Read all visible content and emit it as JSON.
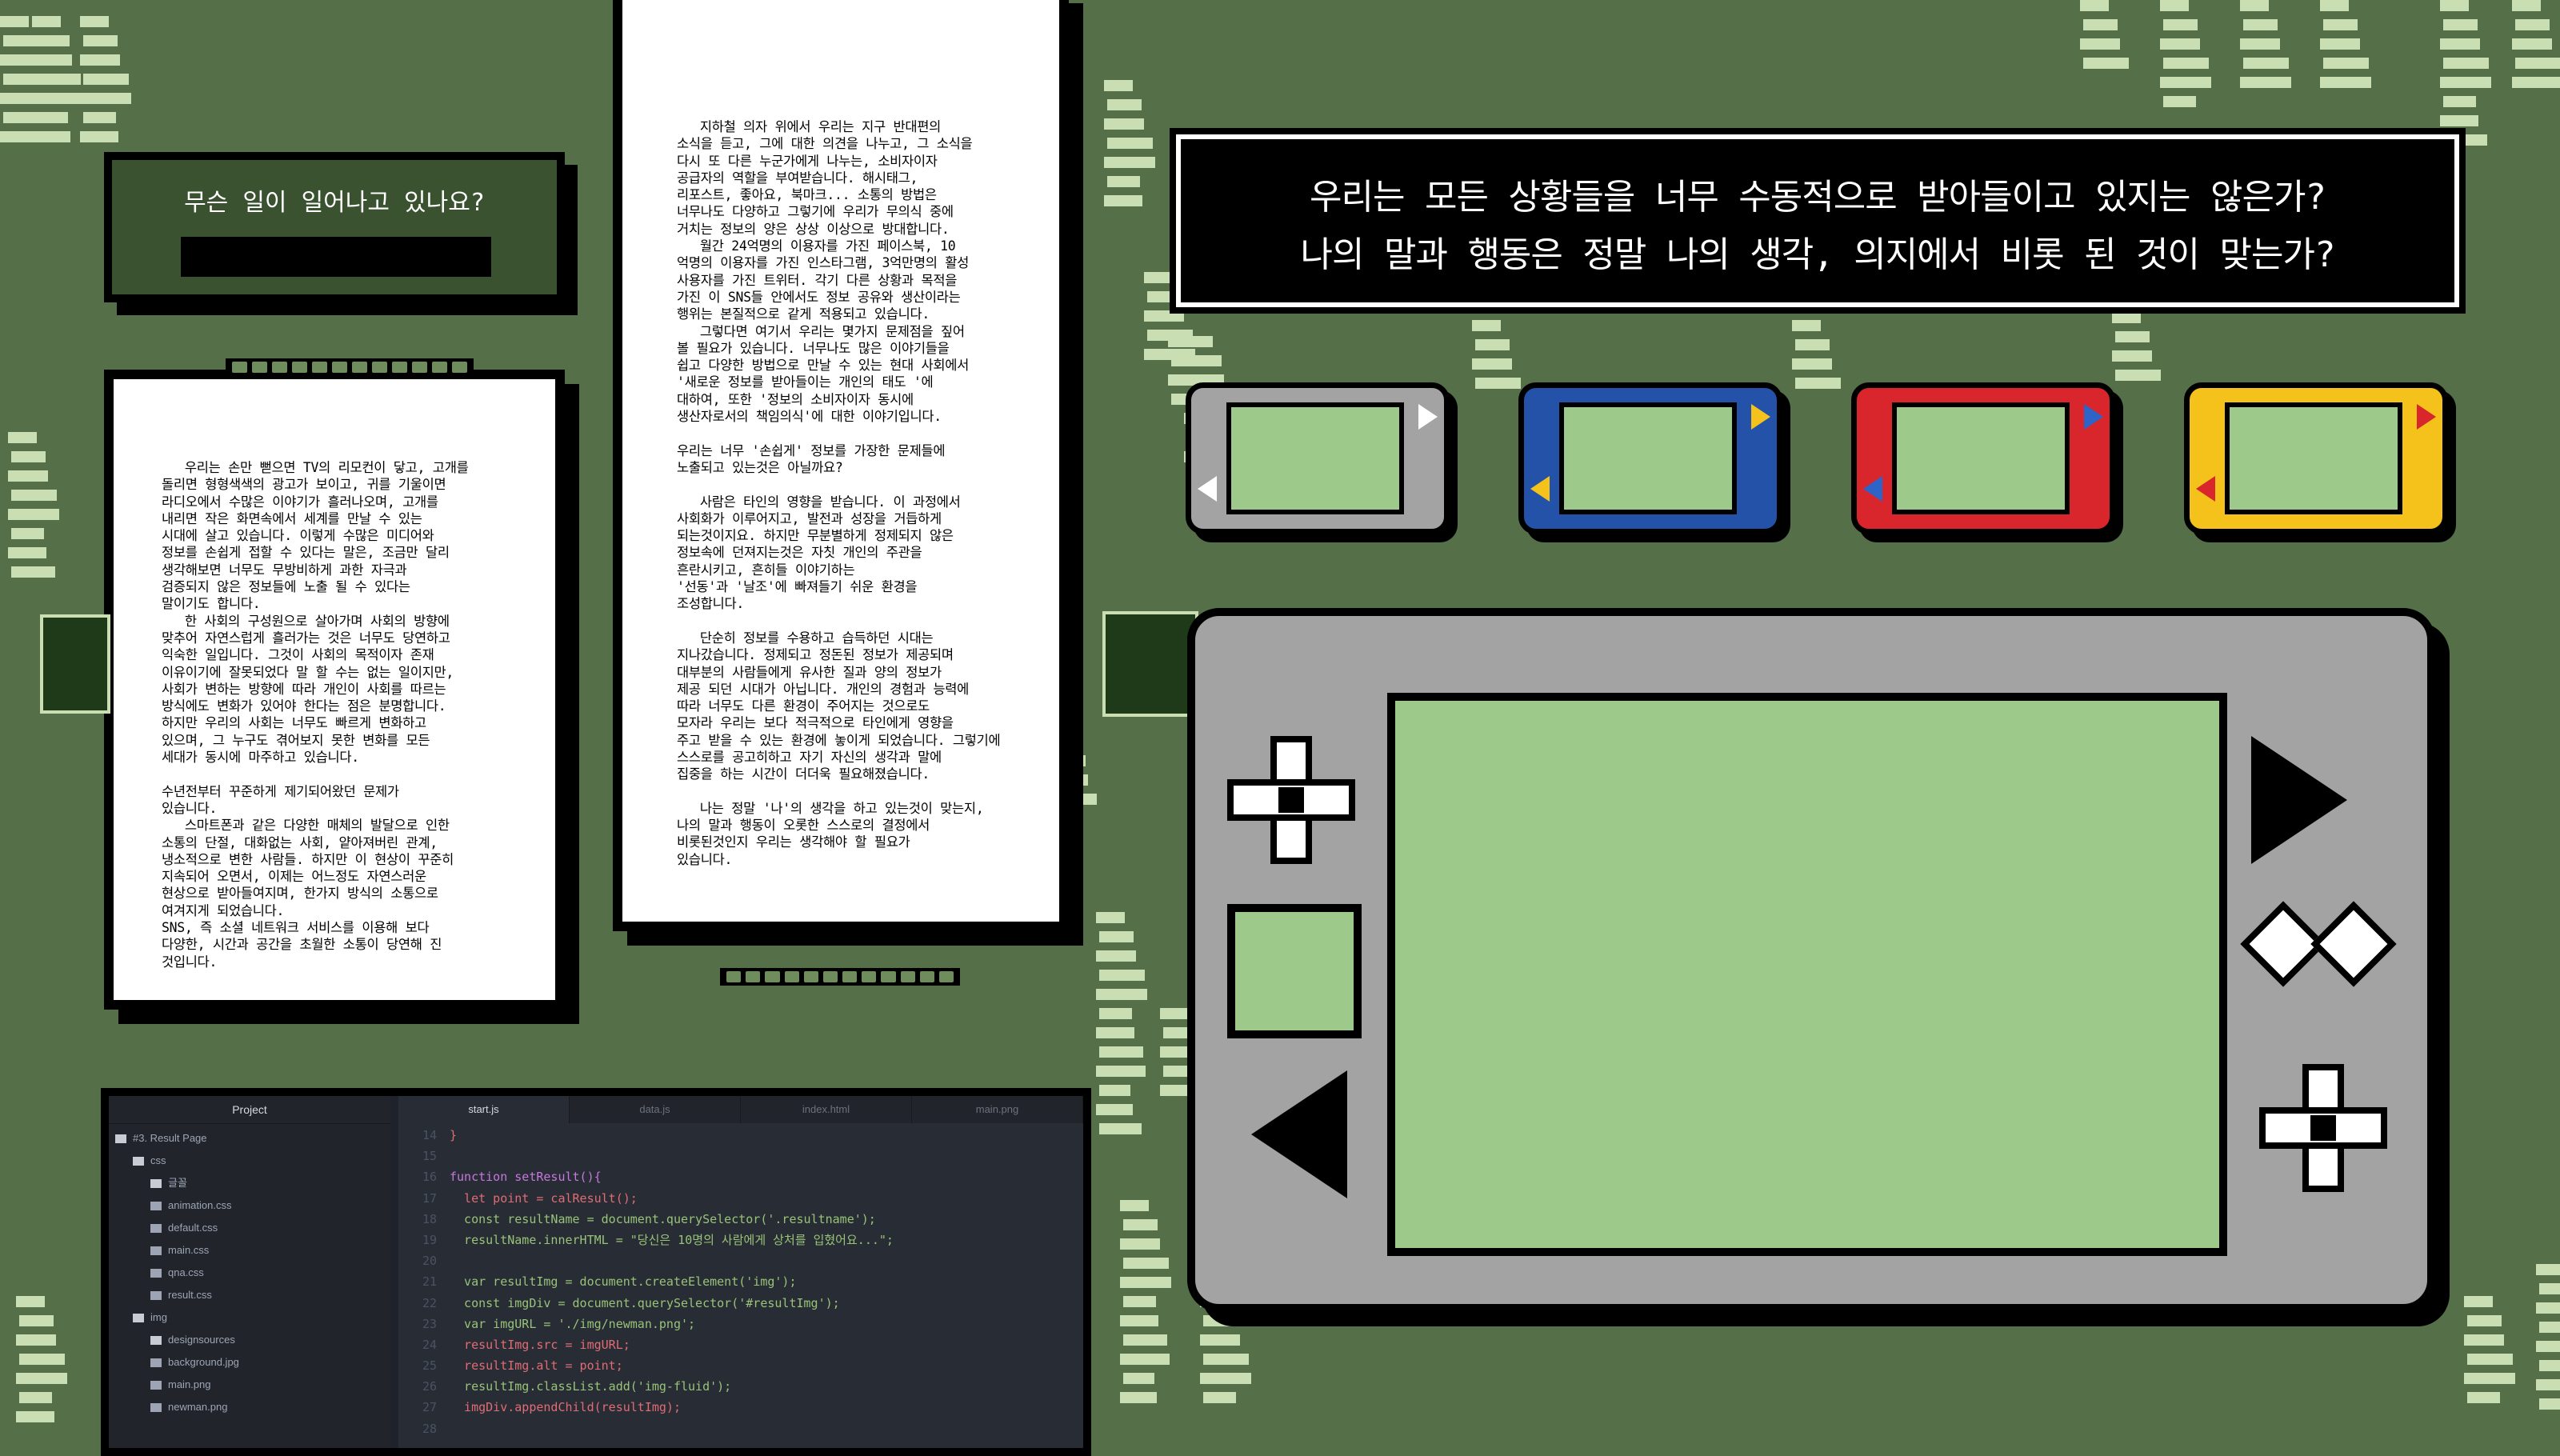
{
  "colors": {
    "background": "#557048",
    "bars": "#c9dfb3",
    "screen": "#9dca8b"
  },
  "question_window": {
    "title": "무슨 일이 일어나고 있나요?"
  },
  "left_paper": {
    "text": "   우리는 손만 뻗으면 TV의 리모컨이 닿고, 고개를\n돌리면 형형색색의 광고가 보이고, 귀를 기울이면\n라디오에서 수많은 이야기가 흘러나오며, 고개를\n내리면 작은 화면속에서 세계를 만날 수 있는\n시대에 살고 있습니다. 이렇게 수많은 미디어와\n정보를 손쉽게 접할 수 있다는 말은, 조금만 달리\n생각해보면 너무도 무방비하게 과한 자극과\n검증되지 않은 정보들에 노출 될 수 있다는\n말이기도 합니다.\n   한 사회의 구성원으로 살아가며 사회의 방향에\n맞추어 자연스럽게 흘러가는 것은 너무도 당연하고\n익숙한 일입니다. 그것이 사회의 목적이자 존재\n이유이기에 잘못되었다 말 할 수는 없는 일이지만,\n사회가 변하는 방향에 따라 개인이 사회를 따르는\n방식에도 변화가 있어야 한다는 점은 분명합니다.\n하지만 우리의 사회는 너무도 빠르게 변화하고\n있으며, 그 누구도 겪어보지 못한 변화를 모든\n세대가 동시에 마주하고 있습니다.\n\n수년전부터 꾸준하게 제기되어왔던 문제가\n있습니다.\n   스마트폰과 같은 다양한 매체의 발달으로 인한\n소통의 단절, 대화없는 사회, 얕아져버린 관계,\n냉소적으로 변한 사람들. 하지만 이 현상이 꾸준히\n지속되어 오면서, 이제는 어느정도 자연스러운\n현상으로 받아들여지며, 한가지 방식의 소통으로\n여겨지게 되었습니다.\nSNS, 즉 소셜 네트워크 서비스를 이용해 보다\n다양한, 시간과 공간을 초월한 소통이 당연해 진\n것입니다."
  },
  "right_paper": {
    "text": "   지하철 의자 위에서 우리는 지구 반대편의\n소식을 듣고, 그에 대한 의견을 나누고, 그 소식을\n다시 또 다른 누군가에게 나누는, 소비자이자\n공급자의 역할을 부여받습니다. 해시태그,\n리포스트, 좋아요, 북마크... 소통의 방법은\n너무나도 다양하고 그렇기에 우리가 무의식 중에\n거치는 정보의 양은 상상 이상으로 방대합니다.\n   월간 24억명의 이용자를 가진 페이스북, 10\n억명의 이용자를 가진 인스타그램, 3억만명의 활성\n사용자를 가진 트위터. 각기 다른 상황과 목적을\n가진 이 SNS들 안에서도 정보 공유와 생산이라는\n행위는 본질적으로 같게 적용되고 있습니다.\n   그렇다면 여기서 우리는 몇가지 문제점을 짚어\n볼 필요가 있습니다. 너무나도 많은 이야기들을\n쉽고 다양한 방법으로 만날 수 있는 현대 사회에서\n'새로운 정보를 받아들이는 개인의 태도 '에\n대하여, 또한 '정보의 소비자이자 동시에\n생산자로서의 책임의식'에 대한 이야기입니다.\n\n우리는 너무 '손쉽게' 정보를 가장한 문제들에\n노출되고 있는것은 아닐까요?\n\n   사람은 타인의 영향을 받습니다. 이 과정에서\n사회화가 이루어지고, 발전과 성장을 거듭하게\n되는것이지요. 하지만 무분별하게 정제되지 않은\n정보속에 던져지는것은 자칫 개인의 주관을\n흔란시키고, 흔히들 이야기하는\n'선동'과 '날조'에 빠져들기 쉬운 환경을\n조성합니다.\n\n   단순히 정보를 수용하고 습득하던 시대는\n지나갔습니다. 정제되고 정돈된 정보가 제공되며\n대부분의 사람들에게 유사한 질과 양의 정보가\n제공 되던 시대가 아닙니다. 개인의 경험과 능력에\n따라 너무도 다른 환경이 주어지는 것으로도\n모자라 우리는 보다 적극적으로 타인에게 영향을\n주고 받을 수 있는 환경에 놓이게 되었습니다. 그렇기에\n스스로를 공고히하고 자기 자신의 생각과 말에\n집중을 하는 시간이 더더욱 필요해졌습니다.\n\n   나는 정말 '나'의 생각을 하고 있는것이 맞는지,\n나의 말과 행동이 오롯한 스스로의 결정에서\n비롯된것인지 우리는 생각해야 할 필요가\n있습니다."
  },
  "banner": {
    "line1": "우리는 모든 상황들을 너무 수동적으로 받아들이고 있지는 않은가?",
    "line2": "나의 말과 행동은 정말 나의 생각, 의지에서 비롯 된 것이 맞는가?"
  },
  "consoles": [
    {
      "name": "gray",
      "body": "#a3a3a3",
      "accent": "#ffffff"
    },
    {
      "name": "blue",
      "body": "#2352a8",
      "accent": "#f4c21b"
    },
    {
      "name": "red",
      "body": "#d8262c",
      "accent": "#2e64c8"
    },
    {
      "name": "yellow",
      "body": "#f4c21b",
      "accent": "#d8262c"
    }
  ],
  "editor": {
    "project_title": "Project",
    "tree": [
      {
        "label": "#3. Result Page",
        "depth": 0,
        "type": "folder-open"
      },
      {
        "label": "css",
        "depth": 1,
        "type": "folder-open"
      },
      {
        "label": "글꼴",
        "depth": 2,
        "type": "folder"
      },
      {
        "label": "animation.css",
        "depth": 2,
        "type": "file"
      },
      {
        "label": "default.css",
        "depth": 2,
        "type": "file"
      },
      {
        "label": "main.css",
        "depth": 2,
        "type": "file"
      },
      {
        "label": "qna.css",
        "depth": 2,
        "type": "file"
      },
      {
        "label": "result.css",
        "depth": 2,
        "type": "file"
      },
      {
        "label": "img",
        "depth": 1,
        "type": "folder-open"
      },
      {
        "label": "designsources",
        "depth": 2,
        "type": "folder"
      },
      {
        "label": "background.jpg",
        "depth": 2,
        "type": "file"
      },
      {
        "label": "main.png",
        "depth": 2,
        "type": "file"
      },
      {
        "label": "newman.png",
        "depth": 2,
        "type": "file"
      }
    ],
    "tabs": [
      "start.js",
      "data.js",
      "index.html",
      "main.png"
    ],
    "lines": [
      {
        "n": "14",
        "t": "}"
      },
      {
        "n": "15",
        "t": ""
      },
      {
        "n": "16",
        "t": "function setResult(){"
      },
      {
        "n": "17",
        "t": "  let point = calResult();"
      },
      {
        "n": "18",
        "t": "  const resultName = document.querySelector('.resultname');"
      },
      {
        "n": "19",
        "t": "  resultName.innerHTML = \"당신은 10명의 사람에게 상처를 입혔어요...\";"
      },
      {
        "n": "20",
        "t": ""
      },
      {
        "n": "21",
        "t": "  var resultImg = document.createElement('img');"
      },
      {
        "n": "22",
        "t": "  const imgDiv = document.querySelector('#resultImg');"
      },
      {
        "n": "23",
        "t": "  var imgURL = './img/newman.png';"
      },
      {
        "n": "24",
        "t": "  resultImg.src = imgURL;"
      },
      {
        "n": "25",
        "t": "  resultImg.alt = point;"
      },
      {
        "n": "26",
        "t": "  resultImg.classList.add('img-fluid');"
      },
      {
        "n": "27",
        "t": "  imgDiv.appendChild(resultImg);"
      },
      {
        "n": "28",
        "t": ""
      }
    ]
  }
}
